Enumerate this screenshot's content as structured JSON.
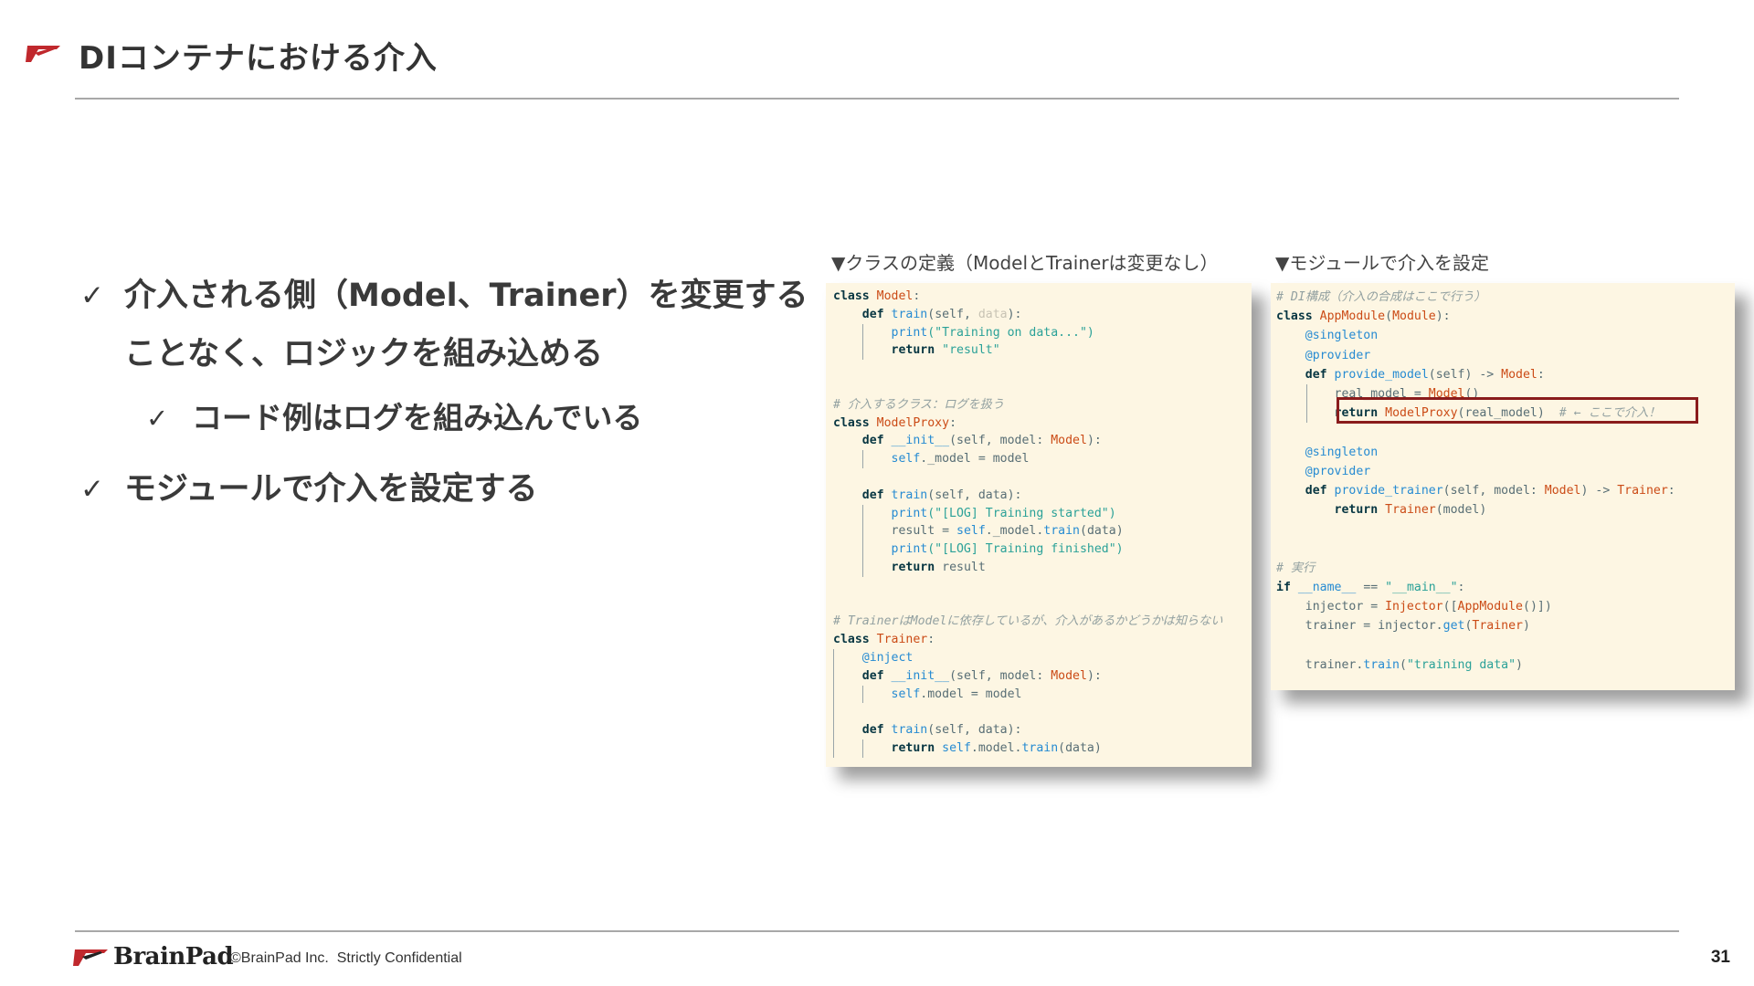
{
  "slide": {
    "title": "DIコンテナにおける介入",
    "page_number": "31"
  },
  "bullets": {
    "check_glyph": "✓",
    "item1_line1": "介入される側（Model、Trainer）を変更する",
    "item1_line2": "ことなく、ロジックを組み込める",
    "sub_item": "コード例はログを組み込んでいる",
    "item2": "モジュールで介入を設定する"
  },
  "captions": {
    "left": "▼クラスの定義（ModelとTrainerは変更なし）",
    "right": "▼モジュールで介入を設定"
  },
  "code_left": {
    "l1": [
      "class",
      "Model",
      ":"
    ],
    "l2": [
      "def",
      "train",
      "(self, ",
      "data",
      "):"
    ],
    "l3": [
      "print",
      "(\"Training on data...\")"
    ],
    "l4": [
      "return",
      "\"result\""
    ],
    "c1": "# 介入するクラス：ログを扱う",
    "l5": [
      "class",
      "ModelProxy",
      ":"
    ],
    "l6": [
      "def",
      "__init__",
      "(self, model: ",
      "Model",
      "):"
    ],
    "l7": [
      "self",
      "._model = model"
    ],
    "l8": [
      "def",
      "train",
      "(self, data):"
    ],
    "l9": [
      "print",
      "(\"[LOG] Training started\")"
    ],
    "l10": [
      "result = ",
      "self",
      "._model.",
      "train",
      "(data)"
    ],
    "l11": [
      "print",
      "(\"[LOG] Training finished\")"
    ],
    "l12": [
      "return",
      "result"
    ],
    "c2": "# TrainerはModelに依存しているが、介入があるかどうかは知らない",
    "l13": [
      "class",
      "Trainer",
      ":"
    ],
    "l14": "@inject",
    "l15": [
      "def",
      "__init__",
      "(self, model: ",
      "Model",
      "):"
    ],
    "l16": [
      "self",
      ".model = model"
    ],
    "l17": [
      "def",
      "train",
      "(self, data):"
    ],
    "l18": [
      "return",
      "self",
      ".model.",
      "train",
      "(data)"
    ]
  },
  "code_right": {
    "c1": "# DI構成（介入の合成はここで行う）",
    "l1": [
      "class",
      "AppModule",
      "(",
      "Module",
      "):"
    ],
    "l2": "@singleton",
    "l3": "@provider",
    "l4": [
      "def",
      "provide_model",
      "(self) -> ",
      "Model",
      ":"
    ],
    "l5": [
      "real_model = ",
      "Model",
      "()"
    ],
    "l6": [
      "return",
      "ModelProxy",
      "(real_model)",
      "# ← ここで介入！"
    ],
    "l7": "@singleton",
    "l8": "@provider",
    "l9": [
      "def",
      "provide_trainer",
      "(self, model: ",
      "Model",
      ") -> ",
      "Trainer",
      ":"
    ],
    "l10": [
      "return",
      "Trainer",
      "(model)"
    ],
    "c2": "# 実行",
    "l11": [
      "if",
      "__name__",
      " == ",
      "\"__main__\"",
      ":"
    ],
    "l12": [
      "injector = ",
      "Injector",
      "([",
      "AppModule",
      "()])"
    ],
    "l13": [
      "trainer = injector.",
      "get",
      "(",
      "Trainer",
      ")"
    ],
    "l14": [
      "trainer.",
      "train",
      "(",
      "\"training data\"",
      ")"
    ]
  },
  "footer": {
    "brand": "BrainPad",
    "copyright": "©BrainPad Inc.  Strictly Confidential"
  },
  "colors": {
    "accent_red": "#c0282d",
    "code_background": "#fdf6e3",
    "highlight_border": "#8a1c1c"
  }
}
